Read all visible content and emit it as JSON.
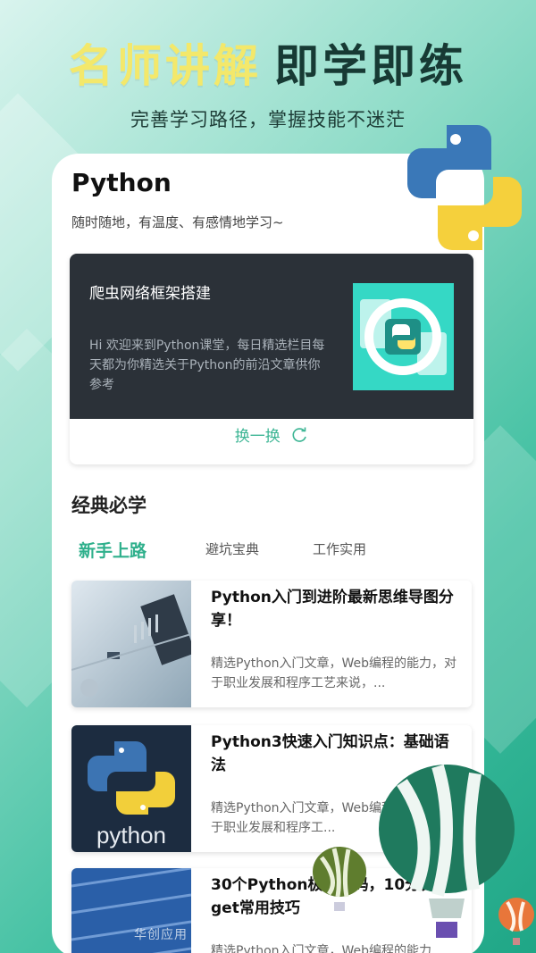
{
  "hero": {
    "title_left": "名师讲解",
    "title_right": "即学即练",
    "subtitle": "完善学习路径，掌握技能不迷茫"
  },
  "card": {
    "title": "Python",
    "desc": "随时随地，有温度、有感情地学习~"
  },
  "feature": {
    "title": "爬虫网络框架搭建",
    "text": "Hi 欢迎来到Python课堂，每日精选栏目每天都为你精选关于Python的前沿文章供你参考",
    "refresh_label": "换一换"
  },
  "section": {
    "title": "经典必学"
  },
  "tabs": [
    "新手上路",
    "避坑宝典",
    "工作实用"
  ],
  "items": [
    {
      "title": "Python入门到进阶最新思维导图分享！",
      "summary": "精选Python入门文章，Web编程的能力，对于职业发展和程序工艺来说，..."
    },
    {
      "title": "Python3快速入门知识点：基础语法",
      "summary": "精选Python入门文章，Web编程的能力，对于职业发展和程序工..."
    },
    {
      "title": "30个Python极简代码，10分钟get常用技巧",
      "summary": "精选Python入门文章，Web编程的能力..."
    }
  ],
  "thumb2_text": "python",
  "watermark": "华创应用 • HUACHUANGZS.COM",
  "colors": {
    "accent": "#2fb08c",
    "hero_yellow": "#f3e86b",
    "hero_dark": "#173a34",
    "feature_bg": "#2b3138"
  }
}
